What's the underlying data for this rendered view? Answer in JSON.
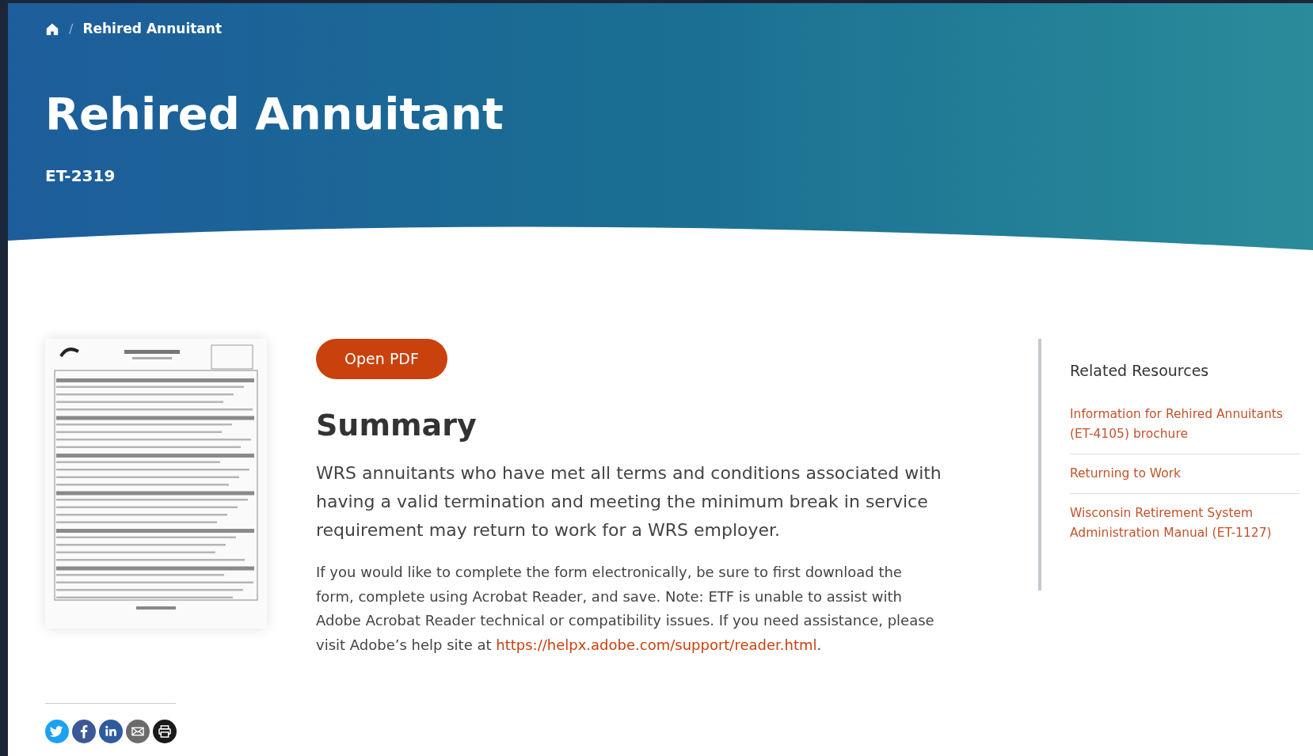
{
  "breadcrumb": {
    "separator": "/",
    "current": "Rehired Annuitant"
  },
  "header": {
    "title": "Rehired Annuitant",
    "form_number": "ET-2319"
  },
  "open_button": "Open PDF",
  "summary": {
    "heading": "Summary",
    "lead": "WRS annuitants who have met all terms and conditions associated with having a valid termination and meeting the minimum break in service requirement may return to work for a WRS employer.",
    "note": "If you would like to complete the form electronically, be sure to first download the form, complete using Acrobat Reader, and save. Note: ETF is unable to assist with Adobe Acrobat Reader technical or compatibility issues. If you need assistance, please visit Adobe’s help site at ",
    "link": "https://helpx.adobe.com/support/reader.html",
    "after_link": "."
  },
  "related": {
    "title": "Related Resources",
    "links": [
      "Information for Rehired Annuitants (ET-4105) brochure",
      "Returning to Work",
      "Wisconsin Retirement System Administration Manual (ET-1127)"
    ]
  },
  "share": [
    {
      "kind": "twitter",
      "color": "#1da1f2"
    },
    {
      "kind": "facebook",
      "color": "#3b5998"
    },
    {
      "kind": "linkedin",
      "color": "#2e5a9e"
    },
    {
      "kind": "email",
      "color": "#6b6b6b"
    },
    {
      "kind": "print",
      "color": "#1a1a1a"
    }
  ]
}
